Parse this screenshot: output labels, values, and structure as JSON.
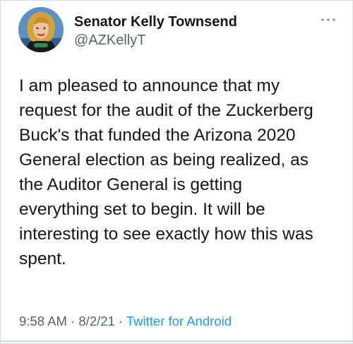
{
  "author": {
    "name": "Senator Kelly Townsend",
    "handle": "@AZKellyT",
    "avatar_icon": "profile-photo-avatar"
  },
  "tweet": {
    "text_lines": [
      "I am pleased to announce that my",
      "request for the audit of the Zuckerberg",
      "Buck's that funded the Arizona 2020",
      "General election as being realized, as",
      "the Auditor General is getting",
      "everything set to begin. It will be",
      "interesting to see exactly how this was",
      "spent."
    ]
  },
  "meta": {
    "time": "9:58 AM",
    "separator": " · ",
    "date": "8/2/21",
    "source": "Twitter for Android"
  },
  "icons": {
    "more": "more-options-icon"
  },
  "colors": {
    "text": "#14171a",
    "secondary": "#536471",
    "link": "#1d9bf0",
    "background": "#ffffff"
  }
}
